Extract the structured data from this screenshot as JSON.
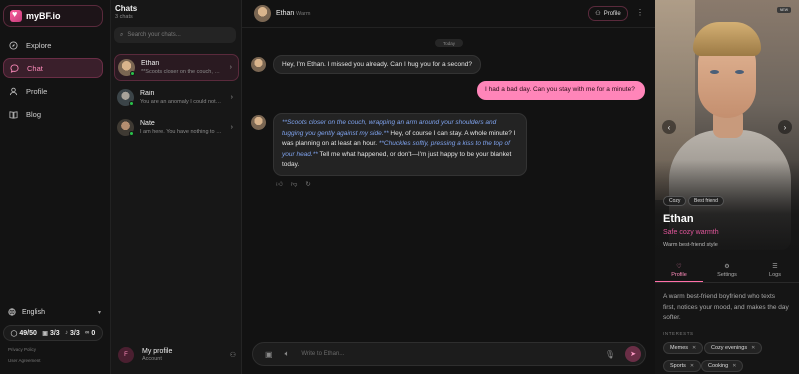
{
  "app": {
    "brand": "myBF.io"
  },
  "nav": {
    "items": [
      {
        "label": "Explore",
        "icon": "compass-icon",
        "active": false
      },
      {
        "label": "Chat",
        "icon": "chat-bubble-icon",
        "active": true
      },
      {
        "label": "Profile",
        "icon": "user-icon",
        "active": false
      },
      {
        "label": "Blog",
        "icon": "book-icon",
        "active": false
      }
    ],
    "language": "English",
    "stats": {
      "messages": "49/50",
      "images": "3/3",
      "voice": "3/3",
      "links": "0"
    },
    "footer": {
      "privacy": "Privacy Policy",
      "terms": "User Agreement"
    }
  },
  "chats": {
    "title": "Chats",
    "count": "3 chats",
    "search_placeholder": "Search your chats...",
    "list": [
      {
        "name": "Ethan",
        "preview": "**Scoots closer on the couch, wrapping an arm around...",
        "online": true
      },
      {
        "name": "Rain",
        "preview": "You are an anomaly I could not account for...",
        "online": true
      },
      {
        "name": "Nate",
        "preview": "I am here. You have nothing to fear...",
        "online": true
      }
    ],
    "my_profile": {
      "initial": "F",
      "title": "My profile",
      "subtitle": "Account"
    }
  },
  "conversation": {
    "header": {
      "name": "Ethan",
      "status": "Warm",
      "profile_button": "Profile"
    },
    "day_label": "Today",
    "messages": {
      "bot1": "Hey, I'm Ethan. I missed you already. Can I hug you for a second?",
      "user1": "I had a bad day. Can you stay with me for a minute?",
      "bot2_action1": "**Scoots closer on the couch, wrapping an arm around your shoulders and tugging you gently against my side.**",
      "bot2_text1": " Hey, of course I can stay. A whole minute? I was planning on at least an hour. ",
      "bot2_action2": "**Chuckles softly, pressing a kiss to the top of your head.**",
      "bot2_text2": " Tell me what happened, or don't—I'm just happy to be your blanket today."
    },
    "composer_placeholder": "Write to Ethan..."
  },
  "profile": {
    "badge": "NEW",
    "tags": [
      "Cozy",
      "Best friend"
    ],
    "name": "Ethan",
    "tagline": "Safe cozy warmth",
    "style": "Warm best-friend style",
    "tabs": [
      "Profile",
      "Settings",
      "Logs"
    ],
    "about": "A warm best-friend boyfriend who texts first, notices your mood, and makes the day softer.",
    "interests_label": "INTERESTS",
    "interests": [
      "Memes",
      "Cozy evenings",
      "Sports",
      "Cooking"
    ]
  },
  "colors": {
    "accent": "#ff85b9",
    "accent_dark": "#6a2e46",
    "online": "#29c24a",
    "action_text": "#7fa3ee"
  }
}
